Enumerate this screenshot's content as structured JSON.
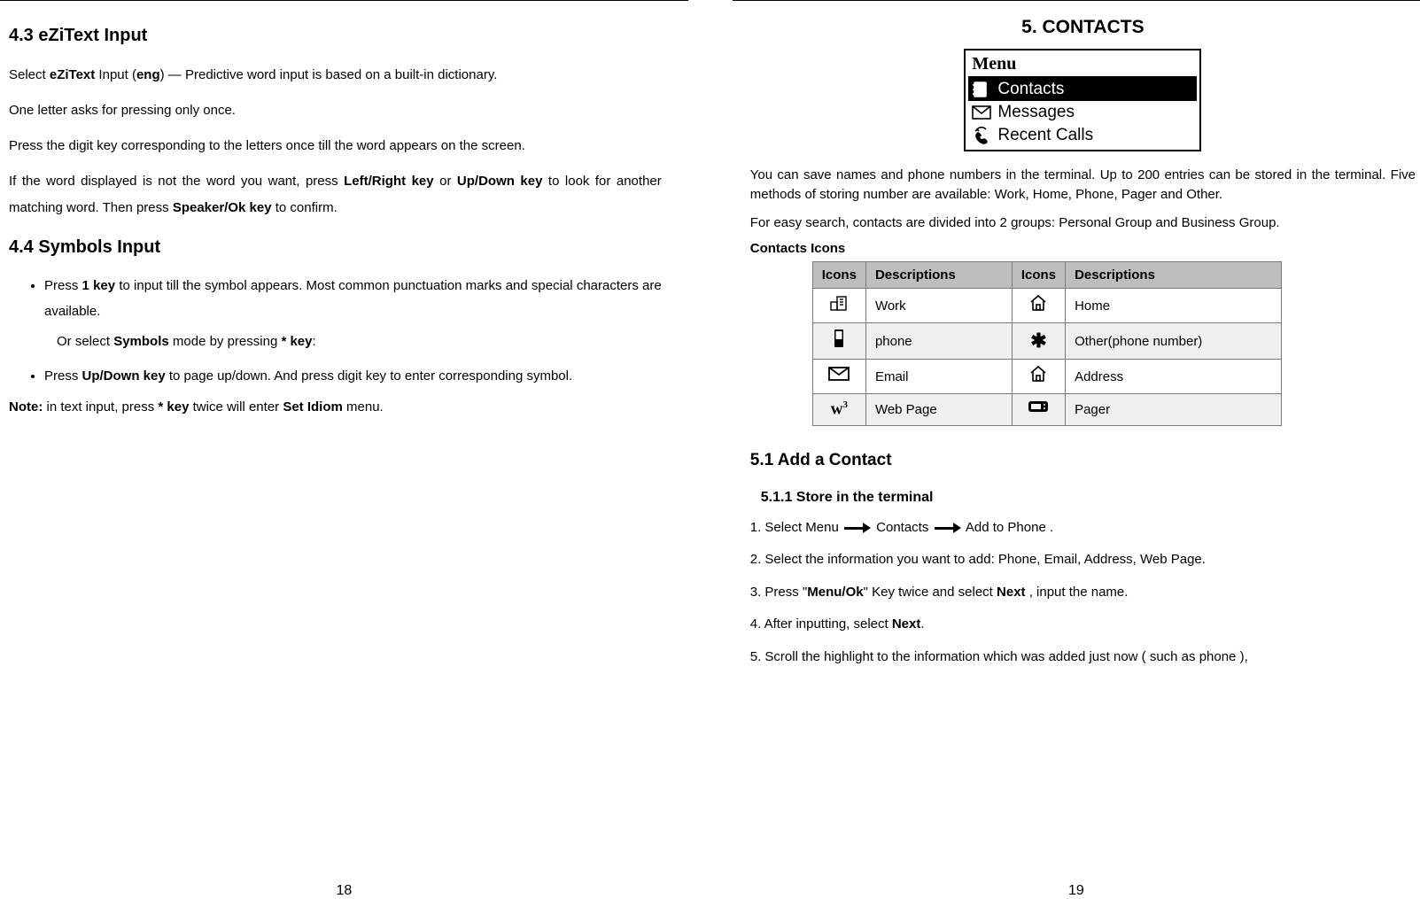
{
  "left": {
    "s43_title": "4.3 eZiText Input",
    "s43_p1_a": "Select ",
    "s43_p1_b": "eZiText",
    "s43_p1_c": " Input (",
    "s43_p1_d": "eng",
    "s43_p1_e": ") — Predictive word input is based on a built-in dictionary.",
    "s43_p2": "One letter asks for pressing only once.",
    "s43_p3": "Press the digit key corresponding to the letters once till the word appears on the screen.",
    "s43_p4_a": "If the word displayed is not the word you want, press ",
    "s43_p4_b": "Left/Right key",
    "s43_p4_c": " or ",
    "s43_p4_d": "Up/Down key",
    "s43_p4_e": " to look for another matching word. Then press ",
    "s43_p4_f": "Speaker/Ok key",
    "s43_p4_g": " to confirm.",
    "s44_title": "4.4 Symbols Input",
    "s44_b1_a": "Press ",
    "s44_b1_b": "1 key",
    "s44_b1_c": " to input till the symbol appears. Most common punctuation marks and special characters are available.",
    "s44_b1_sub_a": "Or select ",
    "s44_b1_sub_b": "Symbols",
    "s44_b1_sub_c": " mode by pressing ",
    "s44_b1_sub_d": "* key",
    "s44_b1_sub_e": ":",
    "s44_b2_a": "Press ",
    "s44_b2_b": "Up/Down key",
    "s44_b2_c": " to page up/down. And press digit key to enter corresponding symbol.",
    "s44_note_a": "Note:",
    "s44_note_b": " in text input, press ",
    "s44_note_c": "* key",
    "s44_note_d": " twice will enter ",
    "s44_note_e": "Set Idiom",
    "s44_note_f": " menu.",
    "pagenum": "18"
  },
  "right": {
    "chapter": "5. CONTACTS",
    "menu_title": "Menu",
    "menu_items": [
      "Contacts",
      "Messages",
      "Recent Calls"
    ],
    "intro1": "You can save names and phone numbers in the terminal. Up to 200 entries can be stored in the terminal. Five methods of storing number are available: Work, Home, Phone, Pager and Other.",
    "intro2": "For easy search, contacts are divided into 2 groups: Personal Group and Business Group.",
    "icons_head": "Contacts Icons",
    "t_h_icons": "Icons",
    "t_h_desc": "Descriptions",
    "rows": [
      {
        "d1": "Work",
        "d2": "Home",
        "alt": false
      },
      {
        "d1": "phone",
        "d2": "Other(phone number)",
        "alt": true
      },
      {
        "d1": "Email",
        "d2": "Address",
        "alt": false
      },
      {
        "d1": "Web Page",
        "d2": "Pager",
        "alt": true
      }
    ],
    "s51_title": "5.1 Add a Contact",
    "s511_title": "5.1.1 Store in the terminal",
    "step1_a": "1. Select Menu",
    "step1_b": "Contacts",
    "step1_c": "Add to Phone .",
    "step2": "2. Select the information you want to add: Phone, Email, Address, Web Page.",
    "step3_a": "3. Press \"",
    "step3_b": "Menu/Ok",
    "step3_c": "\" Key twice and select ",
    "step3_d": "Next",
    "step3_e": " , input the name.",
    "step4_a": "4. After inputting, select ",
    "step4_b": "Next",
    "step4_c": ".",
    "step5": "5. Scroll the highlight to the information which was added just now ( such as phone ),",
    "pagenum": "19"
  }
}
